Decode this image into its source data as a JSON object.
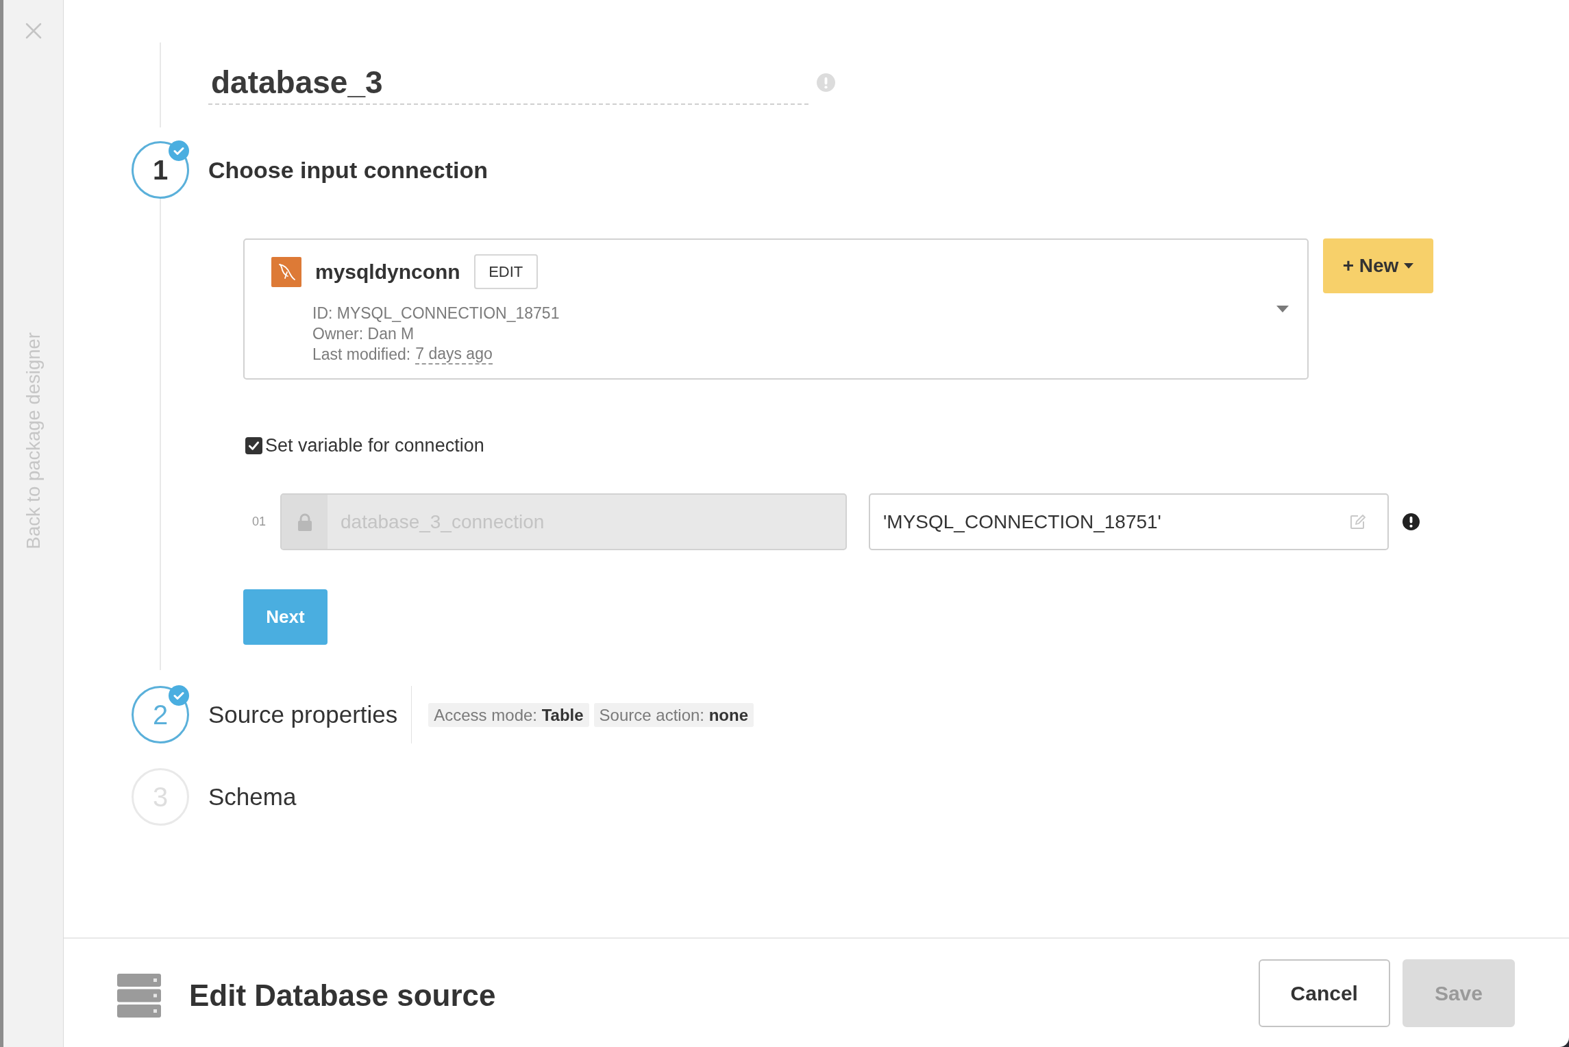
{
  "sidebar": {
    "back_link": "Back to package designer"
  },
  "name_field": {
    "value": "database_3"
  },
  "steps": [
    {
      "number": "1",
      "title": "Choose input connection",
      "selected": true,
      "completed": true,
      "connection": {
        "name": "mysqldynconn",
        "edit_button": "EDIT",
        "details": [
          "ID: MYSQL_CONNECTION_18751",
          "Owner: Dan M"
        ],
        "modified_label": "Last modified:",
        "modified_value": "7 days ago"
      },
      "new_button": "+ New",
      "set_variable": {
        "label": "Set variable for connection",
        "checked": true
      },
      "variables": [
        {
          "index": "01",
          "name": "database_3_connection",
          "disabled": true,
          "value": "'MYSQL_CONNECTION_18751'"
        }
      ],
      "next_button": "Next"
    },
    {
      "number": "2",
      "title": "Source properties",
      "selected": false,
      "completed": true,
      "summary": [
        "Access mode: **Table**",
        "Source action: **none**"
      ]
    },
    {
      "number": "3",
      "title": "Schema",
      "selected": false,
      "completed": false
    }
  ],
  "footer": {
    "title": "Edit Database source",
    "buttons": [
      {
        "label": "Cancel",
        "disabled": false
      },
      {
        "label": "Save",
        "disabled": true
      }
    ]
  }
}
